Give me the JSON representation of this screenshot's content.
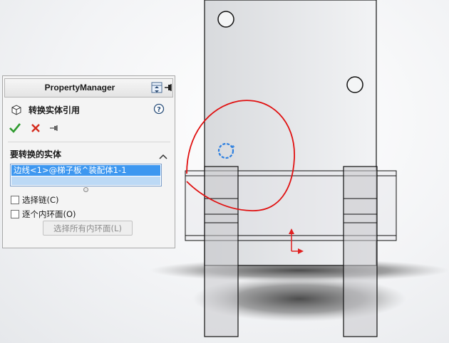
{
  "property_manager": {
    "title": "PropertyManager",
    "feature_title": "转换实体引用",
    "selection_group": {
      "title": "要转换的实体",
      "items": [
        "边线<1>@梯子板^装配体1-1"
      ]
    },
    "options": {
      "select_chain": {
        "label": "选择链(C)",
        "checked": false
      },
      "each_inner_loop": {
        "label": "逐个内环面(O)",
        "checked": false
      }
    },
    "select_all_loops_button": "选择所有内环面(L)"
  },
  "icons": {
    "header": [
      "tree-toggle-icon",
      "pin-icon"
    ],
    "feature": "convert-entities-icon",
    "help": "help-icon",
    "actions": [
      "ok-check-icon",
      "cancel-x-icon",
      "pushpin-icon"
    ],
    "collapse": "chevron-up-icon"
  },
  "colors": {
    "accent_selection": "#3d97f0",
    "ok_green": "#2e9a2e",
    "cancel_red": "#d42a1c",
    "sketch_annotation": "#e01010",
    "triad_red": "#e02020",
    "highlight_blue": "#2c7fe0"
  }
}
